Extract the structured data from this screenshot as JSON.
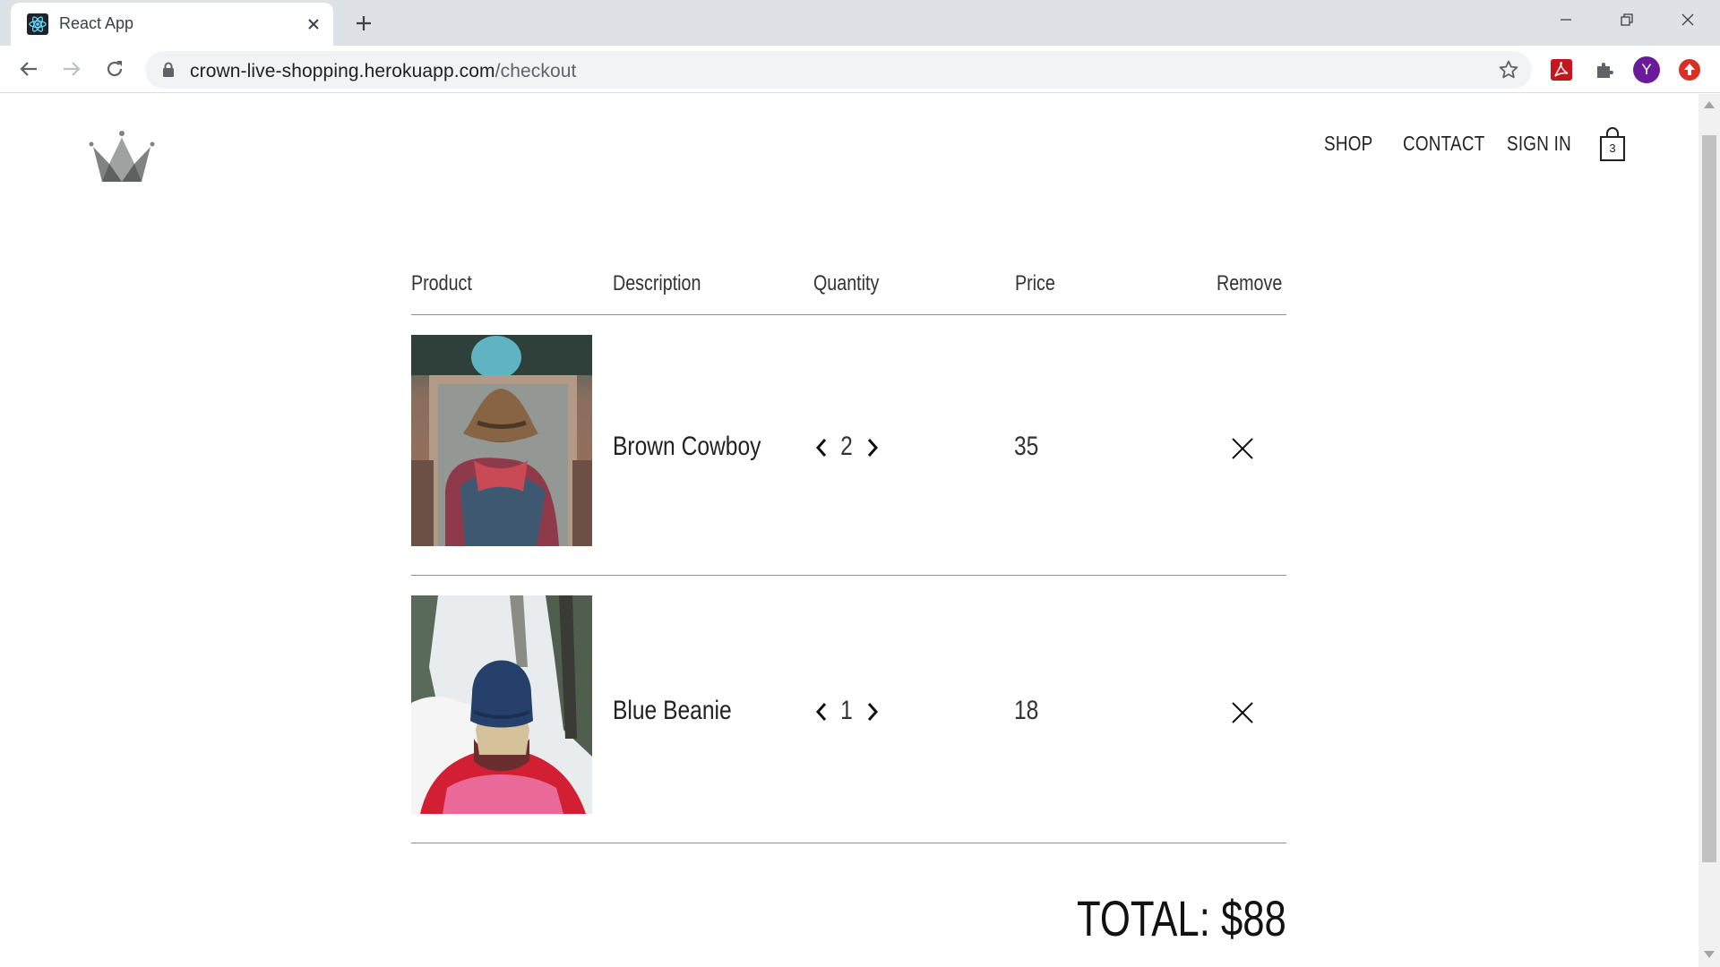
{
  "browser": {
    "tab_title": "React App",
    "url_host": "crown-live-shopping.herokuapp.com",
    "url_path": "/checkout",
    "profile_initial": "Y"
  },
  "header": {
    "nav": [
      {
        "label": "SHOP"
      },
      {
        "label": "CONTACT"
      },
      {
        "label": "SIGN IN"
      }
    ],
    "cart_count": "3"
  },
  "checkout": {
    "columns": [
      "Product",
      "Description",
      "Quantity",
      "Price",
      "Remove"
    ],
    "items": [
      {
        "name": "Brown Cowboy",
        "quantity": "2",
        "price": "35"
      },
      {
        "name": "Blue Beanie",
        "quantity": "1",
        "price": "18"
      }
    ],
    "total": "TOTAL: $88"
  },
  "icons": {
    "favicon": "react-icon",
    "tab_close": "close-icon",
    "new_tab": "plus-icon",
    "back": "arrow-left-icon",
    "forward": "arrow-right-icon",
    "reload": "reload-icon",
    "lock": "lock-icon",
    "bookmark": "star-icon",
    "extensions": [
      "acrobat-icon",
      "puzzle-icon",
      "avatar",
      "update-icon"
    ],
    "logo": "crown-icon",
    "cart": "shopping-bag-icon",
    "decrease": "chevron-left-icon",
    "increase": "chevron-right-icon",
    "remove": "close-icon"
  },
  "colors": {
    "chrome_frame": "#dee1e6",
    "omnibox": "#f1f3f4",
    "profile": "#6a1b9a",
    "update_badge": "#d93025",
    "divider": "#8d8d8d"
  }
}
